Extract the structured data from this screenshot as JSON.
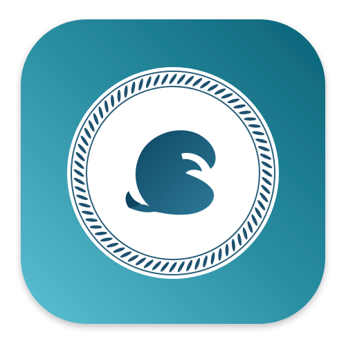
{
  "app_icon": {
    "icon": "whale-logo-icon",
    "emblem": "rope-ring-badge",
    "colors": {
      "background_top_right": "#0b6377",
      "background_mid": "#2b8fa3",
      "background_bottom_left": "#5dbfd2",
      "ring_outer": "#ffffff",
      "ring_line": "#2a5f7a",
      "rope": "#1f5270",
      "badge_fill": "#ffffff",
      "whale_dark": "#0d4560",
      "whale_light": "#2d7a98"
    }
  }
}
